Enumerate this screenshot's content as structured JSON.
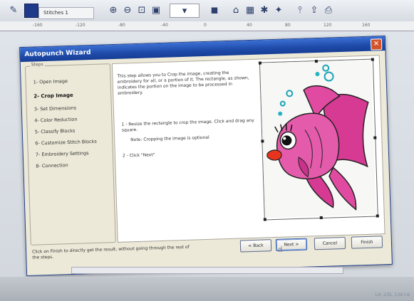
{
  "app": {
    "document_tab": "Stitches 1",
    "ruler_ticks": [
      "-160",
      "-120",
      "-80",
      "-40",
      "0",
      "40",
      "80",
      "120",
      "160"
    ],
    "status_text": "LX: 235, 134 t.6"
  },
  "dialog": {
    "title": "Autopunch Wizard",
    "close_icon": "close-icon",
    "steps_legend": "Steps",
    "steps": [
      {
        "label": "1- Open Image",
        "active": false
      },
      {
        "label": "2- Crop Image",
        "active": true
      },
      {
        "label": "3- Set Dimensions",
        "active": false
      },
      {
        "label": "4- Color Reduction",
        "active": false
      },
      {
        "label": "5- Classify Blocks",
        "active": false
      },
      {
        "label": "6- Customize Stitch Blocks",
        "active": false
      },
      {
        "label": "7- Embroidery Settings",
        "active": false
      },
      {
        "label": "8- Connection",
        "active": false
      }
    ],
    "description": "This step allows you to Crop the image, creating the embroidery for all, or a portion of it. The rectangle, as shown, indicates the portion on the image to be processed in embroidery.",
    "instruction_1": "1 - Resize the rectangle to crop the image. Click and drag any square.",
    "note": "Note: Cropping the image is optional",
    "instruction_2": "2 - Click \"Next\"",
    "footer_text": "Click on Finish to directly get the result, without going through the rest of the steps.",
    "buttons": {
      "back": "< Back",
      "next": "Next >",
      "cancel": "Cancel",
      "finish": "Finish"
    }
  }
}
